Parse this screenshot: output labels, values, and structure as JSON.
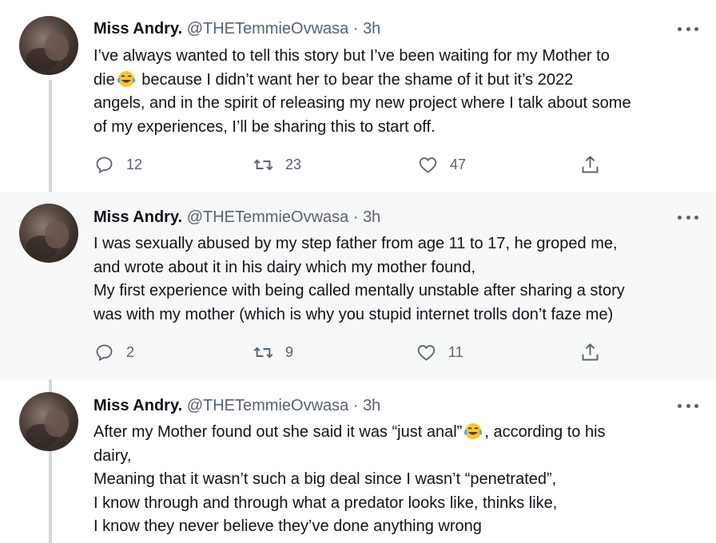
{
  "tweets": [
    {
      "name": "Miss Andry.",
      "handle": "@THETemmieOvwasa",
      "separator": "·",
      "time": "3h",
      "lines": [
        {
          "before": "I’ve always wanted to tell this story but I’ve been waiting for my Mother to",
          "emoji": false
        },
        {
          "before": "die",
          "emoji": true,
          "after": " because I didn’t want her to bear the shame of it but it’s 2022"
        },
        {
          "before": "angels, and in the spirit of releasing my new project where I talk about some",
          "emoji": false
        },
        {
          "before": "of my experiences, I’ll be sharing this to start off.",
          "emoji": false
        }
      ],
      "reply_count": "12",
      "retweet_count": "23",
      "like_count": "47"
    },
    {
      "name": "Miss Andry.",
      "handle": "@THETemmieOvwasa",
      "separator": "·",
      "time": "3h",
      "lines": [
        {
          "before": "I was sexually abused by my step father from age 11 to 17, he groped me,",
          "emoji": false
        },
        {
          "before": "and wrote about it in his dairy which my mother found,",
          "emoji": false
        },
        {
          "before": "My first experience with being called mentally unstable after sharing a story",
          "emoji": false
        },
        {
          "before": "was with my mother (which is why you stupid internet trolls don’t faze me)",
          "emoji": false
        }
      ],
      "reply_count": "2",
      "retweet_count": "9",
      "like_count": "11"
    },
    {
      "name": "Miss Andry.",
      "handle": "@THETemmieOvwasa",
      "separator": "·",
      "time": "3h",
      "lines": [
        {
          "before": "After my Mother found out she said it was “just anal”",
          "emoji": true,
          "after": ", according to his"
        },
        {
          "before": "dairy,",
          "emoji": false
        },
        {
          "before": "Meaning that it wasn’t such a big deal since I wasn’t “penetrated”,",
          "emoji": false
        },
        {
          "before": "I know through and through what a predator looks like, thinks like,",
          "emoji": false
        },
        {
          "before": "I know they never believe they’ve done anything wrong",
          "emoji": false
        }
      ]
    }
  ],
  "icons": {
    "more": "more-horizontal-icon",
    "reply": "reply-icon",
    "retweet": "retweet-icon",
    "like": "heart-icon",
    "share": "share-icon",
    "emoji": "face-with-tears-of-joy"
  },
  "colors": {
    "text": "#0f1419",
    "secondary": "#536471",
    "thread_line": "#cfd9de",
    "highlight_bg": "#f7f9f9"
  }
}
